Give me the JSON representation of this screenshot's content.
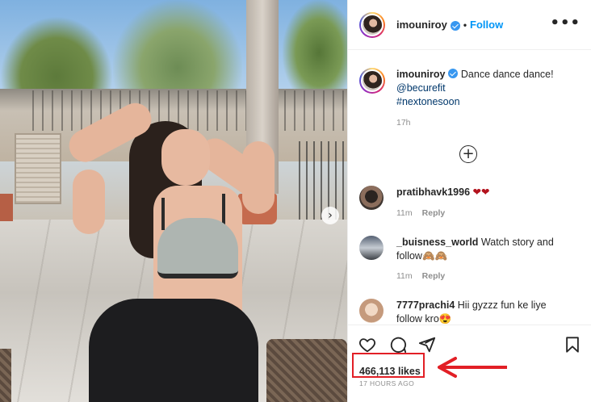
{
  "post": {
    "username": "imouniroy",
    "follow_label": "Follow",
    "separator": "•",
    "more_label": "•••",
    "carousel_next": "›",
    "caption": {
      "username": "imouniroy",
      "text": "Dance dance dance!",
      "mention": "@becurefit",
      "hashtag": "#nextonesoon",
      "time": "17h"
    },
    "load_more": "+",
    "comments": [
      {
        "username": "pratibhavk1996",
        "text": "❤❤",
        "time": "11m",
        "reply": "Reply"
      },
      {
        "username": "_buisness_world",
        "text": "Watch story and follow🙈🙈",
        "time": "11m",
        "reply": "Reply"
      },
      {
        "username": "7777prachi4",
        "text": "Hii gyzzz fun ke liye follow kro😍",
        "time": "",
        "reply": ""
      }
    ],
    "likes": "466,113 likes",
    "time_ago": "17 HOURS AGO"
  },
  "colors": {
    "accent": "#0095f6",
    "verified": "#3897f0",
    "annotation": "#e21f26",
    "heart": "#b3121d"
  },
  "icons": [
    "heart-icon",
    "comment-icon",
    "share-icon",
    "bookmark-icon",
    "more-icon",
    "plus-circle-icon",
    "chevron-right-icon",
    "verified-badge-icon",
    "arrow-left-icon"
  ]
}
